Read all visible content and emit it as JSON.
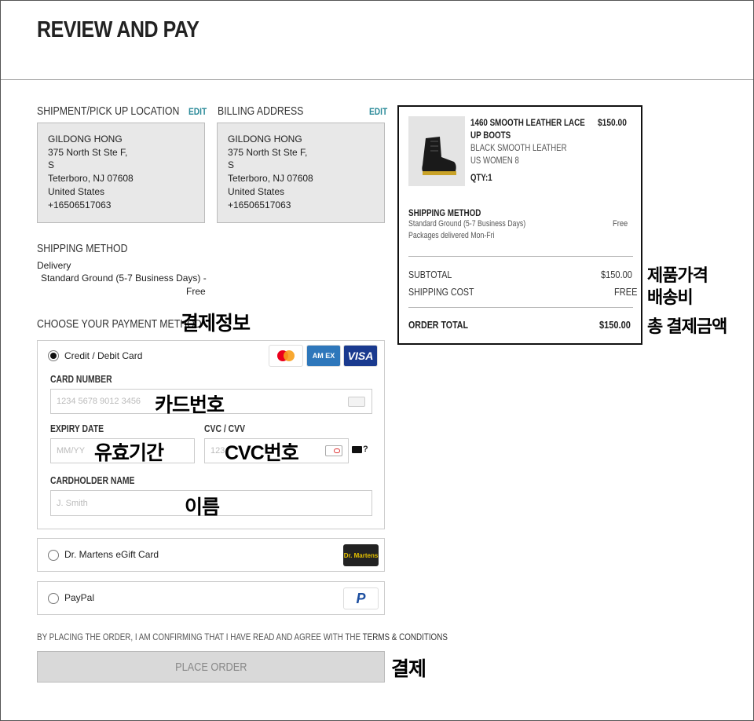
{
  "page": {
    "title": "REVIEW AND PAY"
  },
  "shipment": {
    "label": "SHIPMENT/PICK UP LOCATION",
    "edit": "EDIT",
    "lines": [
      "GILDONG HONG",
      "375 North St Ste F,",
      "S",
      "Teterboro, NJ  07608",
      "United States",
      "+16506517063"
    ]
  },
  "billing": {
    "label": "BILLING ADDRESS",
    "edit": "EDIT",
    "lines": [
      "GILDONG HONG",
      "375 North St Ste F,",
      "S",
      "Teterboro, NJ  07608",
      "United States",
      "+16506517063"
    ]
  },
  "shipping_method": {
    "label": "SHIPPING METHOD",
    "type": "Delivery",
    "detail": "Standard Ground (5-7 Business Days) -",
    "price": "Free"
  },
  "payment": {
    "label": "CHOOSE YOUR PAYMENT METHOD",
    "card_option": "Credit / Debit Card",
    "card_number_label": "CARD NUMBER",
    "card_number_placeholder": "1234 5678 9012 3456",
    "expiry_label": "EXPIRY DATE",
    "expiry_placeholder": "MM/YY",
    "cvc_label": "CVC / CVV",
    "cvc_placeholder": "123",
    "cvc_help": "?",
    "holder_label": "CARDHOLDER NAME",
    "holder_placeholder": "J. Smith",
    "gift_option": "Dr. Martens eGift Card",
    "paypal_option": "PayPal",
    "amex_text": "AM EX",
    "visa_text": "VISA",
    "paypal_logo": "P",
    "gift_logo": "Dr. Martens"
  },
  "terms": {
    "prefix": "BY PLACING THE ORDER, I AM CONFIRMING THAT I HAVE READ AND AGREE WITH THE ",
    "link": "TERMS & CONDITIONS"
  },
  "place_order": "PLACE ORDER",
  "summary": {
    "product_name_1": "1460 SMOOTH LEATHER LACE",
    "product_name_2": "UP BOOTS",
    "product_price": "$150.00",
    "product_color": "BLACK SMOOTH LEATHER",
    "product_size": "US WOMEN 8",
    "product_qty": "QTY:1",
    "ship_label": "SHIPPING METHOD",
    "ship_detail_1": "Standard Ground (5-7 Business Days)",
    "ship_detail_2": "Packages delivered Mon-Fri",
    "ship_price": "Free",
    "subtotal_label": "SUBTOTAL",
    "subtotal_value": "$150.00",
    "shipping_cost_label": "SHIPPING COST",
    "shipping_cost_value": "FREE",
    "total_label": "ORDER TOTAL",
    "total_value": "$150.00"
  },
  "annotations": {
    "payment_info": "결제정보",
    "card_number": "카드번호",
    "expiry": "유효기간",
    "cvc": "CVC번호",
    "name": "이름",
    "product_price": "제품가격",
    "shipping_fee": "배송비",
    "total": "총 결제금액",
    "pay": "결제"
  },
  "colors": {
    "accent": "#2a8a99",
    "box_bg": "#e8e8e8",
    "button_bg": "#d9d9d9"
  }
}
